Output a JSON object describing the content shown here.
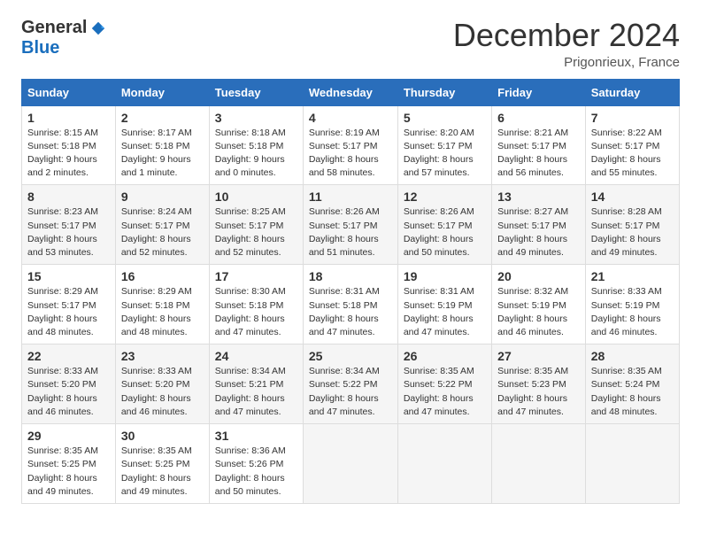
{
  "header": {
    "logo_general": "General",
    "logo_blue": "Blue",
    "month_title": "December 2024",
    "location": "Prigonrieux, France"
  },
  "calendar": {
    "days_of_week": [
      "Sunday",
      "Monday",
      "Tuesday",
      "Wednesday",
      "Thursday",
      "Friday",
      "Saturday"
    ],
    "weeks": [
      [
        null,
        {
          "day": 2,
          "sunrise": "Sunrise: 8:17 AM",
          "sunset": "Sunset: 5:18 PM",
          "daylight": "Daylight: 9 hours and 1 minute."
        },
        {
          "day": 3,
          "sunrise": "Sunrise: 8:18 AM",
          "sunset": "Sunset: 5:18 PM",
          "daylight": "Daylight: 9 hours and 0 minutes."
        },
        {
          "day": 4,
          "sunrise": "Sunrise: 8:19 AM",
          "sunset": "Sunset: 5:17 PM",
          "daylight": "Daylight: 8 hours and 58 minutes."
        },
        {
          "day": 5,
          "sunrise": "Sunrise: 8:20 AM",
          "sunset": "Sunset: 5:17 PM",
          "daylight": "Daylight: 8 hours and 57 minutes."
        },
        {
          "day": 6,
          "sunrise": "Sunrise: 8:21 AM",
          "sunset": "Sunset: 5:17 PM",
          "daylight": "Daylight: 8 hours and 56 minutes."
        },
        {
          "day": 7,
          "sunrise": "Sunrise: 8:22 AM",
          "sunset": "Sunset: 5:17 PM",
          "daylight": "Daylight: 8 hours and 55 minutes."
        }
      ],
      [
        {
          "day": 1,
          "sunrise": "Sunrise: 8:15 AM",
          "sunset": "Sunset: 5:18 PM",
          "daylight": "Daylight: 9 hours and 2 minutes."
        },
        {
          "day": 9,
          "sunrise": "Sunrise: 8:24 AM",
          "sunset": "Sunset: 5:17 PM",
          "daylight": "Daylight: 8 hours and 52 minutes."
        },
        {
          "day": 10,
          "sunrise": "Sunrise: 8:25 AM",
          "sunset": "Sunset: 5:17 PM",
          "daylight": "Daylight: 8 hours and 52 minutes."
        },
        {
          "day": 11,
          "sunrise": "Sunrise: 8:26 AM",
          "sunset": "Sunset: 5:17 PM",
          "daylight": "Daylight: 8 hours and 51 minutes."
        },
        {
          "day": 12,
          "sunrise": "Sunrise: 8:26 AM",
          "sunset": "Sunset: 5:17 PM",
          "daylight": "Daylight: 8 hours and 50 minutes."
        },
        {
          "day": 13,
          "sunrise": "Sunrise: 8:27 AM",
          "sunset": "Sunset: 5:17 PM",
          "daylight": "Daylight: 8 hours and 49 minutes."
        },
        {
          "day": 14,
          "sunrise": "Sunrise: 8:28 AM",
          "sunset": "Sunset: 5:17 PM",
          "daylight": "Daylight: 8 hours and 49 minutes."
        }
      ],
      [
        {
          "day": 8,
          "sunrise": "Sunrise: 8:23 AM",
          "sunset": "Sunset: 5:17 PM",
          "daylight": "Daylight: 8 hours and 53 minutes."
        },
        {
          "day": 16,
          "sunrise": "Sunrise: 8:29 AM",
          "sunset": "Sunset: 5:18 PM",
          "daylight": "Daylight: 8 hours and 48 minutes."
        },
        {
          "day": 17,
          "sunrise": "Sunrise: 8:30 AM",
          "sunset": "Sunset: 5:18 PM",
          "daylight": "Daylight: 8 hours and 47 minutes."
        },
        {
          "day": 18,
          "sunrise": "Sunrise: 8:31 AM",
          "sunset": "Sunset: 5:18 PM",
          "daylight": "Daylight: 8 hours and 47 minutes."
        },
        {
          "day": 19,
          "sunrise": "Sunrise: 8:31 AM",
          "sunset": "Sunset: 5:19 PM",
          "daylight": "Daylight: 8 hours and 47 minutes."
        },
        {
          "day": 20,
          "sunrise": "Sunrise: 8:32 AM",
          "sunset": "Sunset: 5:19 PM",
          "daylight": "Daylight: 8 hours and 46 minutes."
        },
        {
          "day": 21,
          "sunrise": "Sunrise: 8:33 AM",
          "sunset": "Sunset: 5:19 PM",
          "daylight": "Daylight: 8 hours and 46 minutes."
        }
      ],
      [
        {
          "day": 15,
          "sunrise": "Sunrise: 8:29 AM",
          "sunset": "Sunset: 5:17 PM",
          "daylight": "Daylight: 8 hours and 48 minutes."
        },
        {
          "day": 23,
          "sunrise": "Sunrise: 8:33 AM",
          "sunset": "Sunset: 5:20 PM",
          "daylight": "Daylight: 8 hours and 46 minutes."
        },
        {
          "day": 24,
          "sunrise": "Sunrise: 8:34 AM",
          "sunset": "Sunset: 5:21 PM",
          "daylight": "Daylight: 8 hours and 47 minutes."
        },
        {
          "day": 25,
          "sunrise": "Sunrise: 8:34 AM",
          "sunset": "Sunset: 5:22 PM",
          "daylight": "Daylight: 8 hours and 47 minutes."
        },
        {
          "day": 26,
          "sunrise": "Sunrise: 8:35 AM",
          "sunset": "Sunset: 5:22 PM",
          "daylight": "Daylight: 8 hours and 47 minutes."
        },
        {
          "day": 27,
          "sunrise": "Sunrise: 8:35 AM",
          "sunset": "Sunset: 5:23 PM",
          "daylight": "Daylight: 8 hours and 47 minutes."
        },
        {
          "day": 28,
          "sunrise": "Sunrise: 8:35 AM",
          "sunset": "Sunset: 5:24 PM",
          "daylight": "Daylight: 8 hours and 48 minutes."
        }
      ],
      [
        {
          "day": 22,
          "sunrise": "Sunrise: 8:33 AM",
          "sunset": "Sunset: 5:20 PM",
          "daylight": "Daylight: 8 hours and 46 minutes."
        },
        {
          "day": 30,
          "sunrise": "Sunrise: 8:35 AM",
          "sunset": "Sunset: 5:25 PM",
          "daylight": "Daylight: 8 hours and 49 minutes."
        },
        {
          "day": 31,
          "sunrise": "Sunrise: 8:36 AM",
          "sunset": "Sunset: 5:26 PM",
          "daylight": "Daylight: 8 hours and 50 minutes."
        },
        null,
        null,
        null,
        null
      ],
      [
        {
          "day": 29,
          "sunrise": "Sunrise: 8:35 AM",
          "sunset": "Sunset: 5:25 PM",
          "daylight": "Daylight: 8 hours and 49 minutes."
        }
      ]
    ]
  }
}
